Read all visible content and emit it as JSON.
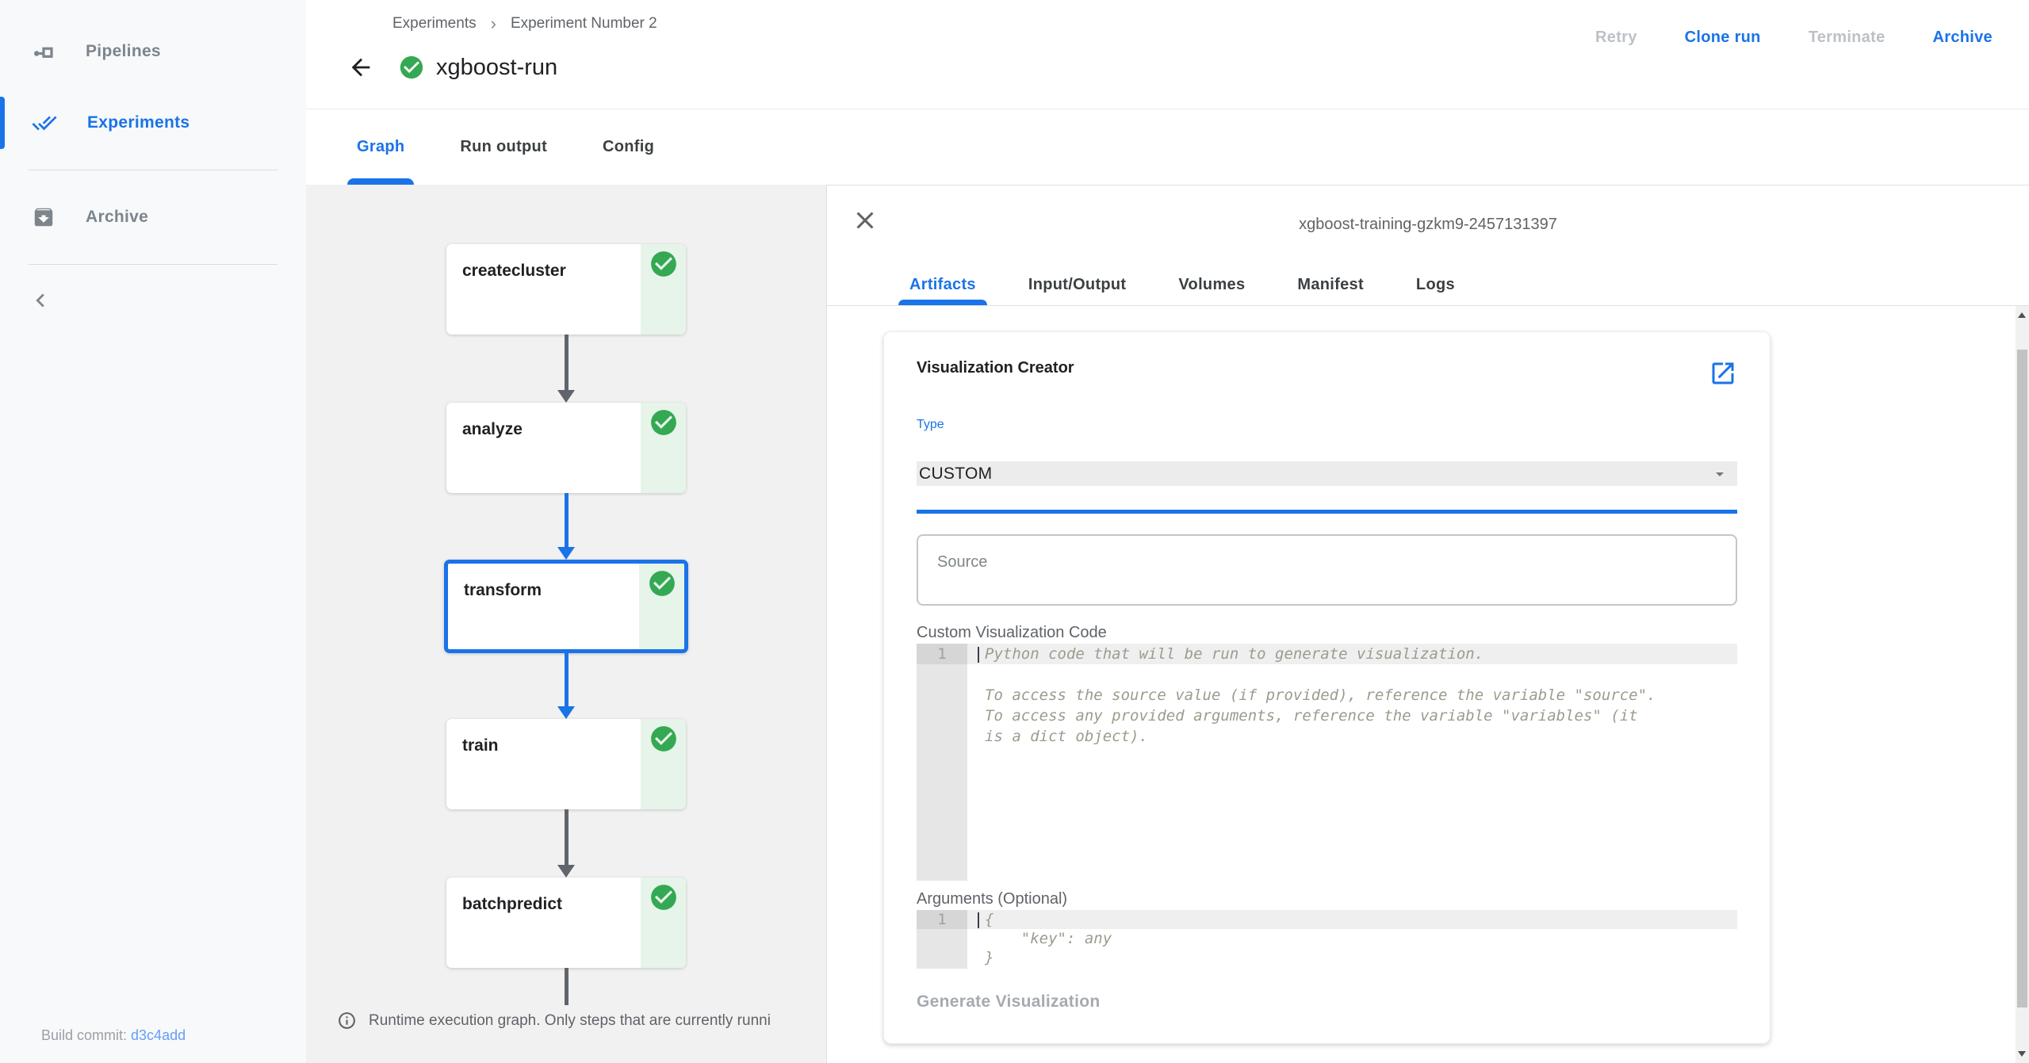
{
  "sidebar": {
    "items": [
      {
        "label": "Pipelines",
        "icon": "pipelines-icon",
        "active": false
      },
      {
        "label": "Experiments",
        "icon": "experiments-icon",
        "active": true
      },
      {
        "label": "Archive",
        "icon": "archive-icon",
        "active": false
      }
    ],
    "collapse_icon": "chevron-left-icon",
    "build_commit": {
      "label": "Build commit: ",
      "value": "d3c4add"
    }
  },
  "header": {
    "breadcrumbs": [
      "Experiments",
      "Experiment Number 2"
    ],
    "breadcrumb_separator": "›",
    "run_status": "succeeded",
    "run_title": "xgboost-run",
    "actions": [
      {
        "label": "Retry",
        "enabled": false
      },
      {
        "label": "Clone run",
        "enabled": true
      },
      {
        "label": "Terminate",
        "enabled": false
      },
      {
        "label": "Archive",
        "enabled": true
      }
    ]
  },
  "run_tabs": {
    "items": [
      "Graph",
      "Run output",
      "Config"
    ],
    "active": "Graph"
  },
  "graph": {
    "nodes": [
      {
        "label": "createcluster",
        "status": "succeeded",
        "selected": false
      },
      {
        "label": "analyze",
        "status": "succeeded",
        "selected": false
      },
      {
        "label": "transform",
        "status": "succeeded",
        "selected": true
      },
      {
        "label": "train",
        "status": "succeeded",
        "selected": false
      },
      {
        "label": "batchpredict",
        "status": "succeeded",
        "selected": false
      }
    ],
    "info_text": "Runtime execution graph. Only steps that are currently runni"
  },
  "panel": {
    "title": "xgboost-training-gzkm9-2457131397",
    "tabs": {
      "items": [
        "Artifacts",
        "Input/Output",
        "Volumes",
        "Manifest",
        "Logs"
      ],
      "active": "Artifacts"
    },
    "card": {
      "title": "Visualization Creator",
      "type_label": "Type",
      "type_value": "CUSTOM",
      "source_placeholder": "Source",
      "code_label": "Custom Visualization Code",
      "code_gutter": "1",
      "code_lines": [
        "Python code that will be run to generate visualization.",
        "",
        "To access the source value (if provided), reference the variable \"source\".",
        "To access any provided arguments, reference the variable \"variables\" (it",
        "is a dict object)."
      ],
      "args_label": "Arguments (Optional)",
      "args_gutter": "1",
      "args_lines": [
        "{",
        "    \"key\": any",
        "}"
      ],
      "generate_label": "Generate Visualization"
    }
  },
  "colors": {
    "accent": "#1a73e8",
    "success": "#34a853",
    "success_bg": "#e6f4ea",
    "disabled": "#bdc1c6"
  }
}
